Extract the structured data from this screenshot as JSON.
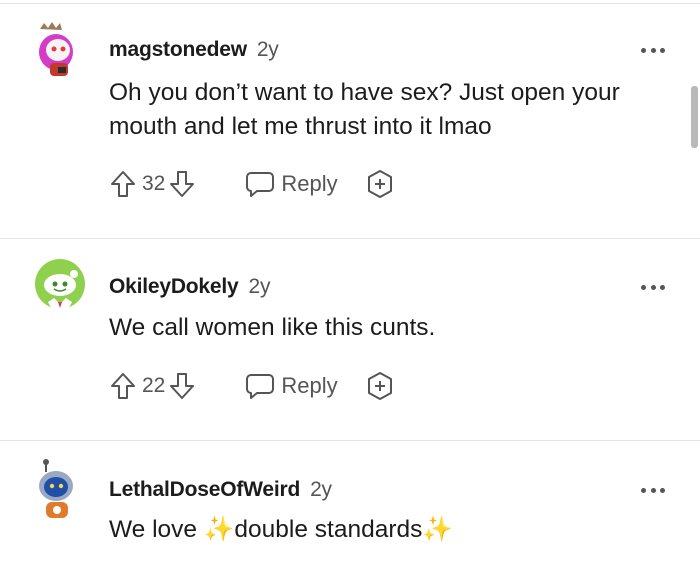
{
  "comments": [
    {
      "username": "magstonedew",
      "age": "2y",
      "lines": [
        "Oh you don’t want to have sex? Just open your",
        "mouth and let me thrust into it lmao"
      ],
      "score": "32",
      "reply_label": "Reply",
      "avatar_icon": "snoo-avatar-pink-hair-crown-icon"
    },
    {
      "username": "OkileyDokely",
      "age": "2y",
      "lines": [
        "We call women like this cunts."
      ],
      "score": "22",
      "reply_label": "Reply",
      "avatar_icon": "snoo-avatar-green-icon"
    },
    {
      "username": "LethalDoseOfWeird",
      "age": "2y",
      "text_parts": [
        "We love ",
        "double standards"
      ],
      "sparkle": "✨",
      "avatar_icon": "snoo-avatar-blue-helmet-icon"
    }
  ],
  "colors": {
    "text": "#1c1c1c",
    "muted": "#555555",
    "divider": "#e3e3e3",
    "sparkle": "#f2c12e"
  }
}
